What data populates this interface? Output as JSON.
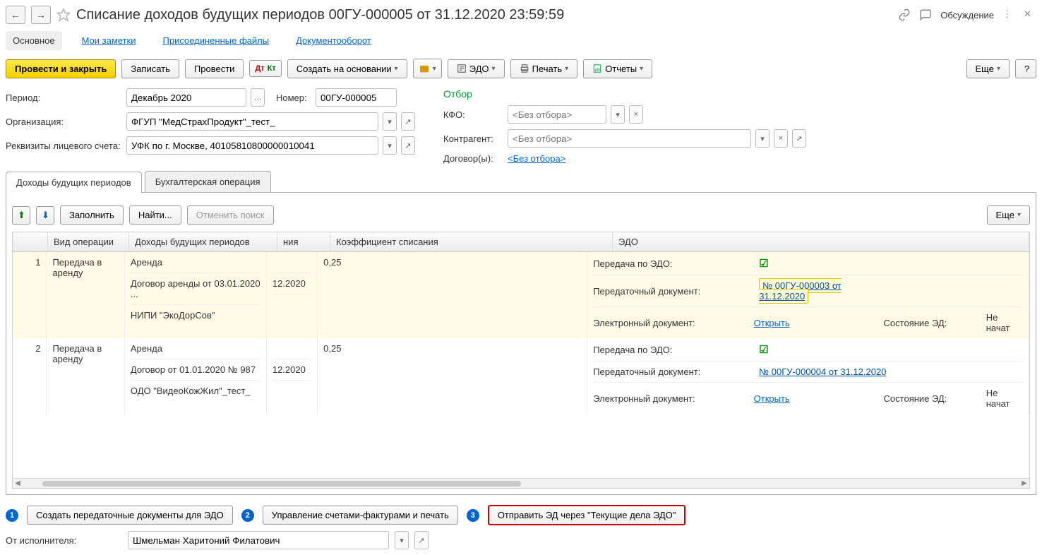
{
  "header": {
    "title": "Списание доходов будущих периодов 00ГУ-000005 от 31.12.2020 23:59:59",
    "discussion": "Обсуждение"
  },
  "subtabs": {
    "main": "Основное",
    "notes": "Мои заметки",
    "files": "Присоединенные файлы",
    "docflow": "Документооборот"
  },
  "toolbar": {
    "post_close": "Провести и закрыть",
    "save": "Записать",
    "post": "Провести",
    "create_based": "Создать на основании",
    "edo": "ЭДО",
    "print": "Печать",
    "reports": "Отчеты",
    "more": "Еще",
    "help": "?"
  },
  "form": {
    "period_label": "Период:",
    "period_value": "Декабрь 2020",
    "number_label": "Номер:",
    "number_value": "00ГУ-000005",
    "org_label": "Организация:",
    "org_value": "ФГУП \"МедСтрахПродукт\"_тест_",
    "account_label": "Реквизиты лицевого счета:",
    "account_value": "УФК по г. Москве, 40105810800000010041",
    "filter_title": "Отбор",
    "kfo_label": "КФО:",
    "kfo_placeholder": "<Без отбора>",
    "counterparty_label": "Контрагент:",
    "counterparty_placeholder": "<Без отбора>",
    "contract_label": "Договор(ы):",
    "contract_link": "<Без отбора>"
  },
  "tabs": {
    "incomes": "Доходы будущих периодов",
    "acc_op": "Бухгалтерская операция"
  },
  "innerToolbar": {
    "fill": "Заполнить",
    "find": "Найти...",
    "cancel_find": "Отменить поиск",
    "more": "Еще"
  },
  "gridHead": {
    "op": "Вид операции",
    "doh": "Доходы будущих периодов",
    "niya": "ния",
    "koef": "Коэффициент списания",
    "edo": "ЭДО"
  },
  "rows": [
    {
      "num": "1",
      "operation": "Передача в аренду",
      "doh": [
        "Аренда",
        "Договор аренды от 03.01.2020 ...",
        "НИПИ \"ЭкоДорСов\""
      ],
      "niya": [
        "",
        "12.2020",
        ""
      ],
      "koef": "0,25",
      "edo": {
        "transfer_label": "Передача по ЭДО:",
        "transfer_checked": true,
        "handover_label": "Передаточный документ:",
        "handover_link": "№ 00ГУ-000003 от 31.12.2020",
        "edoc_label": "Электронный документ:",
        "open": "Открыть",
        "state_label": "Состояние ЭД:",
        "state_value": "Не начат"
      }
    },
    {
      "num": "2",
      "operation": "Передача в аренду",
      "doh": [
        "Аренда",
        "Договор от 01.01.2020 № 987",
        "ОДО \"ВидеоКожЖил\"_тест_"
      ],
      "niya": [
        "",
        "12.2020",
        ""
      ],
      "koef": "0,25",
      "edo": {
        "transfer_label": "Передача по ЭДО:",
        "transfer_checked": true,
        "handover_label": "Передаточный документ:",
        "handover_link": "№ 00ГУ-000004 от 31.12.2020",
        "edoc_label": "Электронный документ:",
        "open": "Открыть",
        "state_label": "Состояние ЭД:",
        "state_value": "Не начат"
      }
    }
  ],
  "bottom": {
    "b1": "Создать передаточные документы для ЭДО",
    "b2": "Управление счетами-фактурами и печать",
    "b3": "Отправить ЭД через \"Текущие дела ЭДО\"",
    "from_label": "От исполнителя:",
    "from_value": "Шмельман Харитоний Филатович"
  }
}
